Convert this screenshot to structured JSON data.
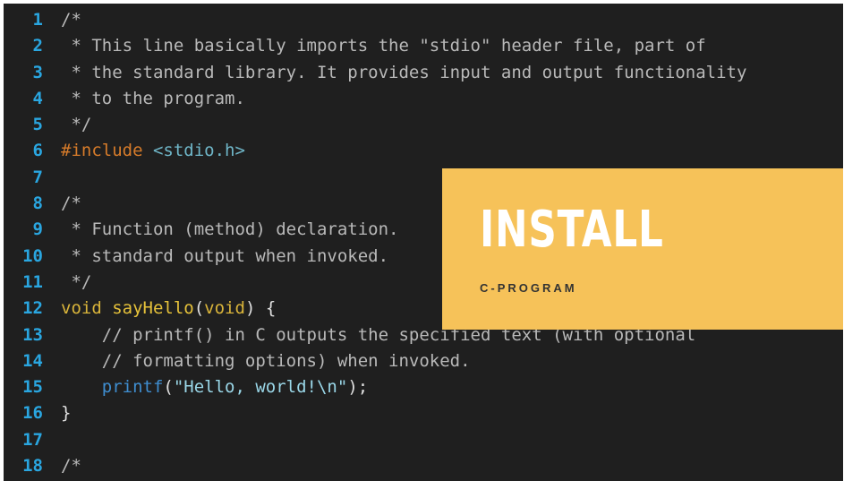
{
  "code_lines": [
    {
      "n": "1",
      "segments": [
        {
          "c": "t-comment",
          "t": "/*"
        }
      ]
    },
    {
      "n": "2",
      "segments": [
        {
          "c": "t-comment",
          "t": " * This line basically imports the \"stdio\" header file, part of"
        }
      ]
    },
    {
      "n": "3",
      "segments": [
        {
          "c": "t-comment",
          "t": " * the standard library. It provides input and output functionality"
        }
      ]
    },
    {
      "n": "4",
      "segments": [
        {
          "c": "t-comment",
          "t": " * to the program."
        }
      ]
    },
    {
      "n": "5",
      "segments": [
        {
          "c": "t-comment",
          "t": " */"
        }
      ]
    },
    {
      "n": "6",
      "segments": [
        {
          "c": "t-pre",
          "t": "#include "
        },
        {
          "c": "t-inc",
          "t": "<stdio.h>"
        }
      ]
    },
    {
      "n": "7",
      "segments": []
    },
    {
      "n": "8",
      "segments": [
        {
          "c": "t-comment",
          "t": "/*"
        }
      ]
    },
    {
      "n": "9",
      "segments": [
        {
          "c": "t-comment",
          "t": " * Function (method) declaration."
        }
      ]
    },
    {
      "n": "10",
      "segments": [
        {
          "c": "t-comment",
          "t": " * standard output when invoked."
        }
      ]
    },
    {
      "n": "11",
      "segments": [
        {
          "c": "t-comment",
          "t": " */"
        }
      ]
    },
    {
      "n": "12",
      "segments": [
        {
          "c": "t-kw",
          "t": "void "
        },
        {
          "c": "t-fn",
          "t": "sayHello"
        },
        {
          "c": "t-plain",
          "t": "("
        },
        {
          "c": "t-kw",
          "t": "void"
        },
        {
          "c": "t-plain",
          "t": ") {"
        }
      ]
    },
    {
      "n": "13",
      "segments": [
        {
          "c": "t-comment",
          "t": "    // printf() in C outputs the specified text (with optional"
        }
      ]
    },
    {
      "n": "14",
      "segments": [
        {
          "c": "t-comment",
          "t": "    // formatting options) when invoked."
        }
      ]
    },
    {
      "n": "15",
      "segments": [
        {
          "c": "t-call",
          "t": "    printf"
        },
        {
          "c": "t-plain",
          "t": "("
        },
        {
          "c": "t-str",
          "t": "\"Hello, world!\\n\""
        },
        {
          "c": "t-plain",
          "t": ");"
        }
      ]
    },
    {
      "n": "16",
      "segments": [
        {
          "c": "t-plain",
          "t": "}"
        }
      ]
    },
    {
      "n": "17",
      "segments": []
    },
    {
      "n": "18",
      "segments": [
        {
          "c": "t-comment",
          "t": "/*"
        }
      ]
    }
  ],
  "banner": {
    "title": "INSTALL",
    "subtitle": "C-PROGRAM",
    "background_color": "#f6c259"
  }
}
